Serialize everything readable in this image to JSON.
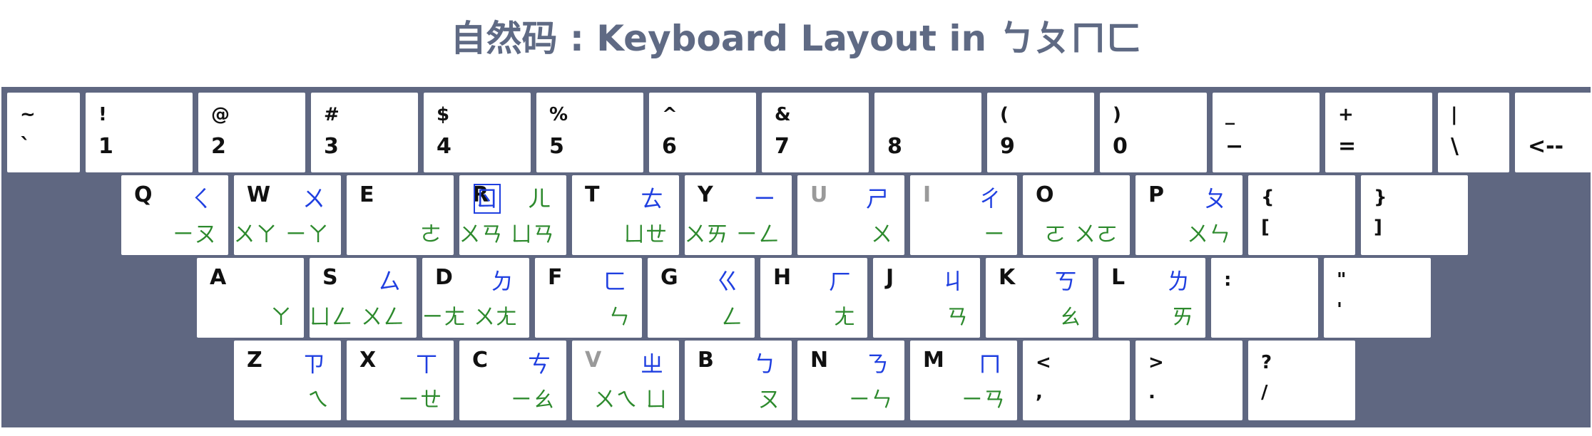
{
  "title": "自然码 : Keyboard Layout in ㄅㄆㄇㄈ",
  "rows": [
    [
      {
        "top": "~",
        "bottom": "`"
      },
      {
        "top": "!",
        "bottom": "1"
      },
      {
        "top": "@",
        "bottom": "2"
      },
      {
        "top": "#",
        "bottom": "3"
      },
      {
        "top": "$",
        "bottom": "4"
      },
      {
        "top": "%",
        "bottom": "5"
      },
      {
        "top": "^",
        "bottom": "6"
      },
      {
        "top": "&",
        "bottom": "7"
      },
      {
        "top": "",
        "bottom": "8"
      },
      {
        "top": "(",
        "bottom": "9"
      },
      {
        "top": ")",
        "bottom": "0"
      },
      {
        "top": "_",
        "bottom": "−"
      },
      {
        "top": "+",
        "bottom": "="
      },
      {
        "top": "|",
        "bottom": "\\"
      },
      {
        "top": "",
        "bottom": "<--"
      }
    ],
    [
      {
        "top": "Q",
        "zhuyin": "ㄑ",
        "finals": "ㄧㄡ"
      },
      {
        "top": "W",
        "zhuyin": "ㄨ",
        "finals": "ㄨㄚ ㄧㄚ"
      },
      {
        "top": "E",
        "zhuyin": "",
        "finals": "ㄜ"
      },
      {
        "top": "R",
        "zhuyin": "ㄖ ㄦ",
        "finals": "ㄨㄢ ㄩㄢ"
      },
      {
        "top": "T",
        "zhuyin": "ㄊ",
        "finals": "ㄩㄝ"
      },
      {
        "top": "Y",
        "zhuyin": "ㄧ",
        "finals": "ㄨㄞ ㄧㄥ"
      },
      {
        "top": "U",
        "zhuyin": "ㄕ",
        "finals": "ㄨ",
        "dim": true
      },
      {
        "top": "I",
        "zhuyin": "ㄔ",
        "finals": "ㄧ",
        "dim": true
      },
      {
        "top": "O",
        "zhuyin": "",
        "finals": "ㄛ ㄨㄛ"
      },
      {
        "top": "P",
        "zhuyin": "ㄆ",
        "finals": "ㄨㄣ"
      },
      {
        "top": "{",
        "bottom": "["
      },
      {
        "top": "}",
        "bottom": "]"
      }
    ],
    [
      {
        "top": "A",
        "zhuyin": "",
        "finals": "ㄚ"
      },
      {
        "top": "S",
        "zhuyin": "ㄙ",
        "finals": "ㄩㄥ ㄨㄥ"
      },
      {
        "top": "D",
        "zhuyin": "ㄉ",
        "finals": "ㄧㄤ ㄨㄤ"
      },
      {
        "top": "F",
        "zhuyin": "ㄈ",
        "finals": "ㄣ"
      },
      {
        "top": "G",
        "zhuyin": "ㄍ",
        "finals": "ㄥ"
      },
      {
        "top": "H",
        "zhuyin": "ㄏ",
        "finals": "ㄤ"
      },
      {
        "top": "J",
        "zhuyin": "ㄐ",
        "finals": "ㄢ"
      },
      {
        "top": "K",
        "zhuyin": "ㄎ",
        "finals": "ㄠ"
      },
      {
        "top": "L",
        "zhuyin": "ㄌ",
        "finals": "ㄞ"
      },
      {
        "top": ":",
        "bottom": ""
      },
      {
        "top": "\"",
        "bottom": "'"
      }
    ],
    [
      {
        "top": "Z",
        "zhuyin": "ㄗ",
        "finals": "ㄟ"
      },
      {
        "top": "X",
        "zhuyin": "ㄒ",
        "finals": "ㄧㄝ"
      },
      {
        "top": "C",
        "zhuyin": "ㄘ",
        "finals": "ㄧㄠ"
      },
      {
        "top": "V",
        "zhuyin": "ㄓ",
        "finals": "ㄨㄟ ㄩ",
        "dim": true
      },
      {
        "top": "B",
        "zhuyin": "ㄅ",
        "finals": "ㄡ"
      },
      {
        "top": "N",
        "zhuyin": "ㄋ",
        "finals": "ㄧㄣ"
      },
      {
        "top": "M",
        "zhuyin": "ㄇ",
        "finals": "ㄧㄢ"
      },
      {
        "top": "<",
        "bottom": ","
      },
      {
        "top": ">",
        "bottom": "."
      },
      {
        "top": "?",
        "bottom": "/"
      }
    ]
  ]
}
